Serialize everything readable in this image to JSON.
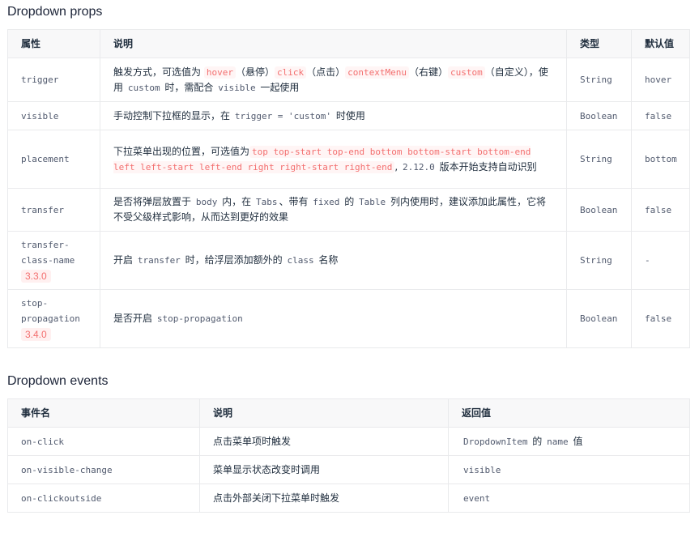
{
  "props": {
    "heading": "Dropdown props",
    "headers": [
      "属性",
      "说明",
      "类型",
      "默认值"
    ],
    "rows": [
      {
        "name": "trigger",
        "type": "String",
        "default": "hover",
        "desc": [
          {
            "t": "text",
            "v": "触发方式，可选值为 "
          },
          {
            "t": "code",
            "v": "hover"
          },
          {
            "t": "text",
            "v": "（悬停）"
          },
          {
            "t": "code",
            "v": "click"
          },
          {
            "t": "text",
            "v": "（点击）"
          },
          {
            "t": "code",
            "v": "contextMenu"
          },
          {
            "t": "text",
            "v": "（右键）"
          },
          {
            "t": "code",
            "v": "custom"
          },
          {
            "t": "text",
            "v": "（自定义），使用 "
          },
          {
            "t": "plain",
            "v": "custom"
          },
          {
            "t": "text",
            "v": " 时，需配合 "
          },
          {
            "t": "plain",
            "v": "visible"
          },
          {
            "t": "text",
            "v": " 一起使用"
          }
        ]
      },
      {
        "name": "visible",
        "type": "Boolean",
        "default": "false",
        "desc": [
          {
            "t": "text",
            "v": "手动控制下拉框的显示，在 "
          },
          {
            "t": "plain",
            "v": "trigger = 'custom'"
          },
          {
            "t": "text",
            "v": " 时使用"
          }
        ]
      },
      {
        "name": "placement",
        "type": "String",
        "default": "bottom",
        "desc": [
          {
            "t": "text",
            "v": "下拉菜单出现的位置，可选值为"
          },
          {
            "t": "code",
            "v": "top top-start top-end bottom bottom-start bottom-end left left-start left-end right right-start right-end"
          },
          {
            "t": "text",
            "v": ", "
          },
          {
            "t": "plain",
            "v": "2.12.0"
          },
          {
            "t": "text",
            "v": " 版本开始支持自动识别"
          }
        ]
      },
      {
        "name": "transfer",
        "type": "Boolean",
        "default": "false",
        "desc": [
          {
            "t": "text",
            "v": "是否将弹层放置于 "
          },
          {
            "t": "plain",
            "v": "body"
          },
          {
            "t": "text",
            "v": " 内，在 "
          },
          {
            "t": "plain",
            "v": "Tabs"
          },
          {
            "t": "text",
            "v": "、带有 "
          },
          {
            "t": "plain",
            "v": "fixed"
          },
          {
            "t": "text",
            "v": " 的 "
          },
          {
            "t": "plain",
            "v": "Table"
          },
          {
            "t": "text",
            "v": " 列内使用时，建议添加此属性，它将不受父级样式影响，从而达到更好的效果"
          }
        ]
      },
      {
        "name": "transfer-class-name",
        "version": "3.3.0",
        "type": "String",
        "default": "-",
        "desc": [
          {
            "t": "text",
            "v": "开启 "
          },
          {
            "t": "plain",
            "v": "transfer"
          },
          {
            "t": "text",
            "v": " 时，给浮层添加额外的 "
          },
          {
            "t": "plain",
            "v": "class"
          },
          {
            "t": "text",
            "v": " 名称"
          }
        ]
      },
      {
        "name": "stop-propagation",
        "version": "3.4.0",
        "type": "Boolean",
        "default": "false",
        "desc": [
          {
            "t": "text",
            "v": "是否开启 "
          },
          {
            "t": "plain",
            "v": "stop-propagation"
          }
        ]
      }
    ]
  },
  "events": {
    "heading": "Dropdown events",
    "headers": [
      "事件名",
      "说明",
      "返回值"
    ],
    "rows": [
      {
        "name": "on-click",
        "desc": "点击菜单项时触发",
        "ret": [
          {
            "t": "plain",
            "v": "DropdownItem"
          },
          {
            "t": "text",
            "v": " 的 "
          },
          {
            "t": "plain",
            "v": "name"
          },
          {
            "t": "text",
            "v": " 值"
          }
        ]
      },
      {
        "name": "on-visible-change",
        "desc": "菜单显示状态改变时调用",
        "ret": [
          {
            "t": "plain",
            "v": "visible"
          }
        ]
      },
      {
        "name": "on-clickoutside",
        "desc": "点击外部关闭下拉菜单时触发",
        "ret": [
          {
            "t": "plain",
            "v": "event"
          }
        ]
      }
    ]
  },
  "colors": {
    "code_text": "#f36f6f",
    "code_bg": "#fff5f5",
    "header_bg": "#f8f8f9",
    "border": "#e9eaec"
  }
}
